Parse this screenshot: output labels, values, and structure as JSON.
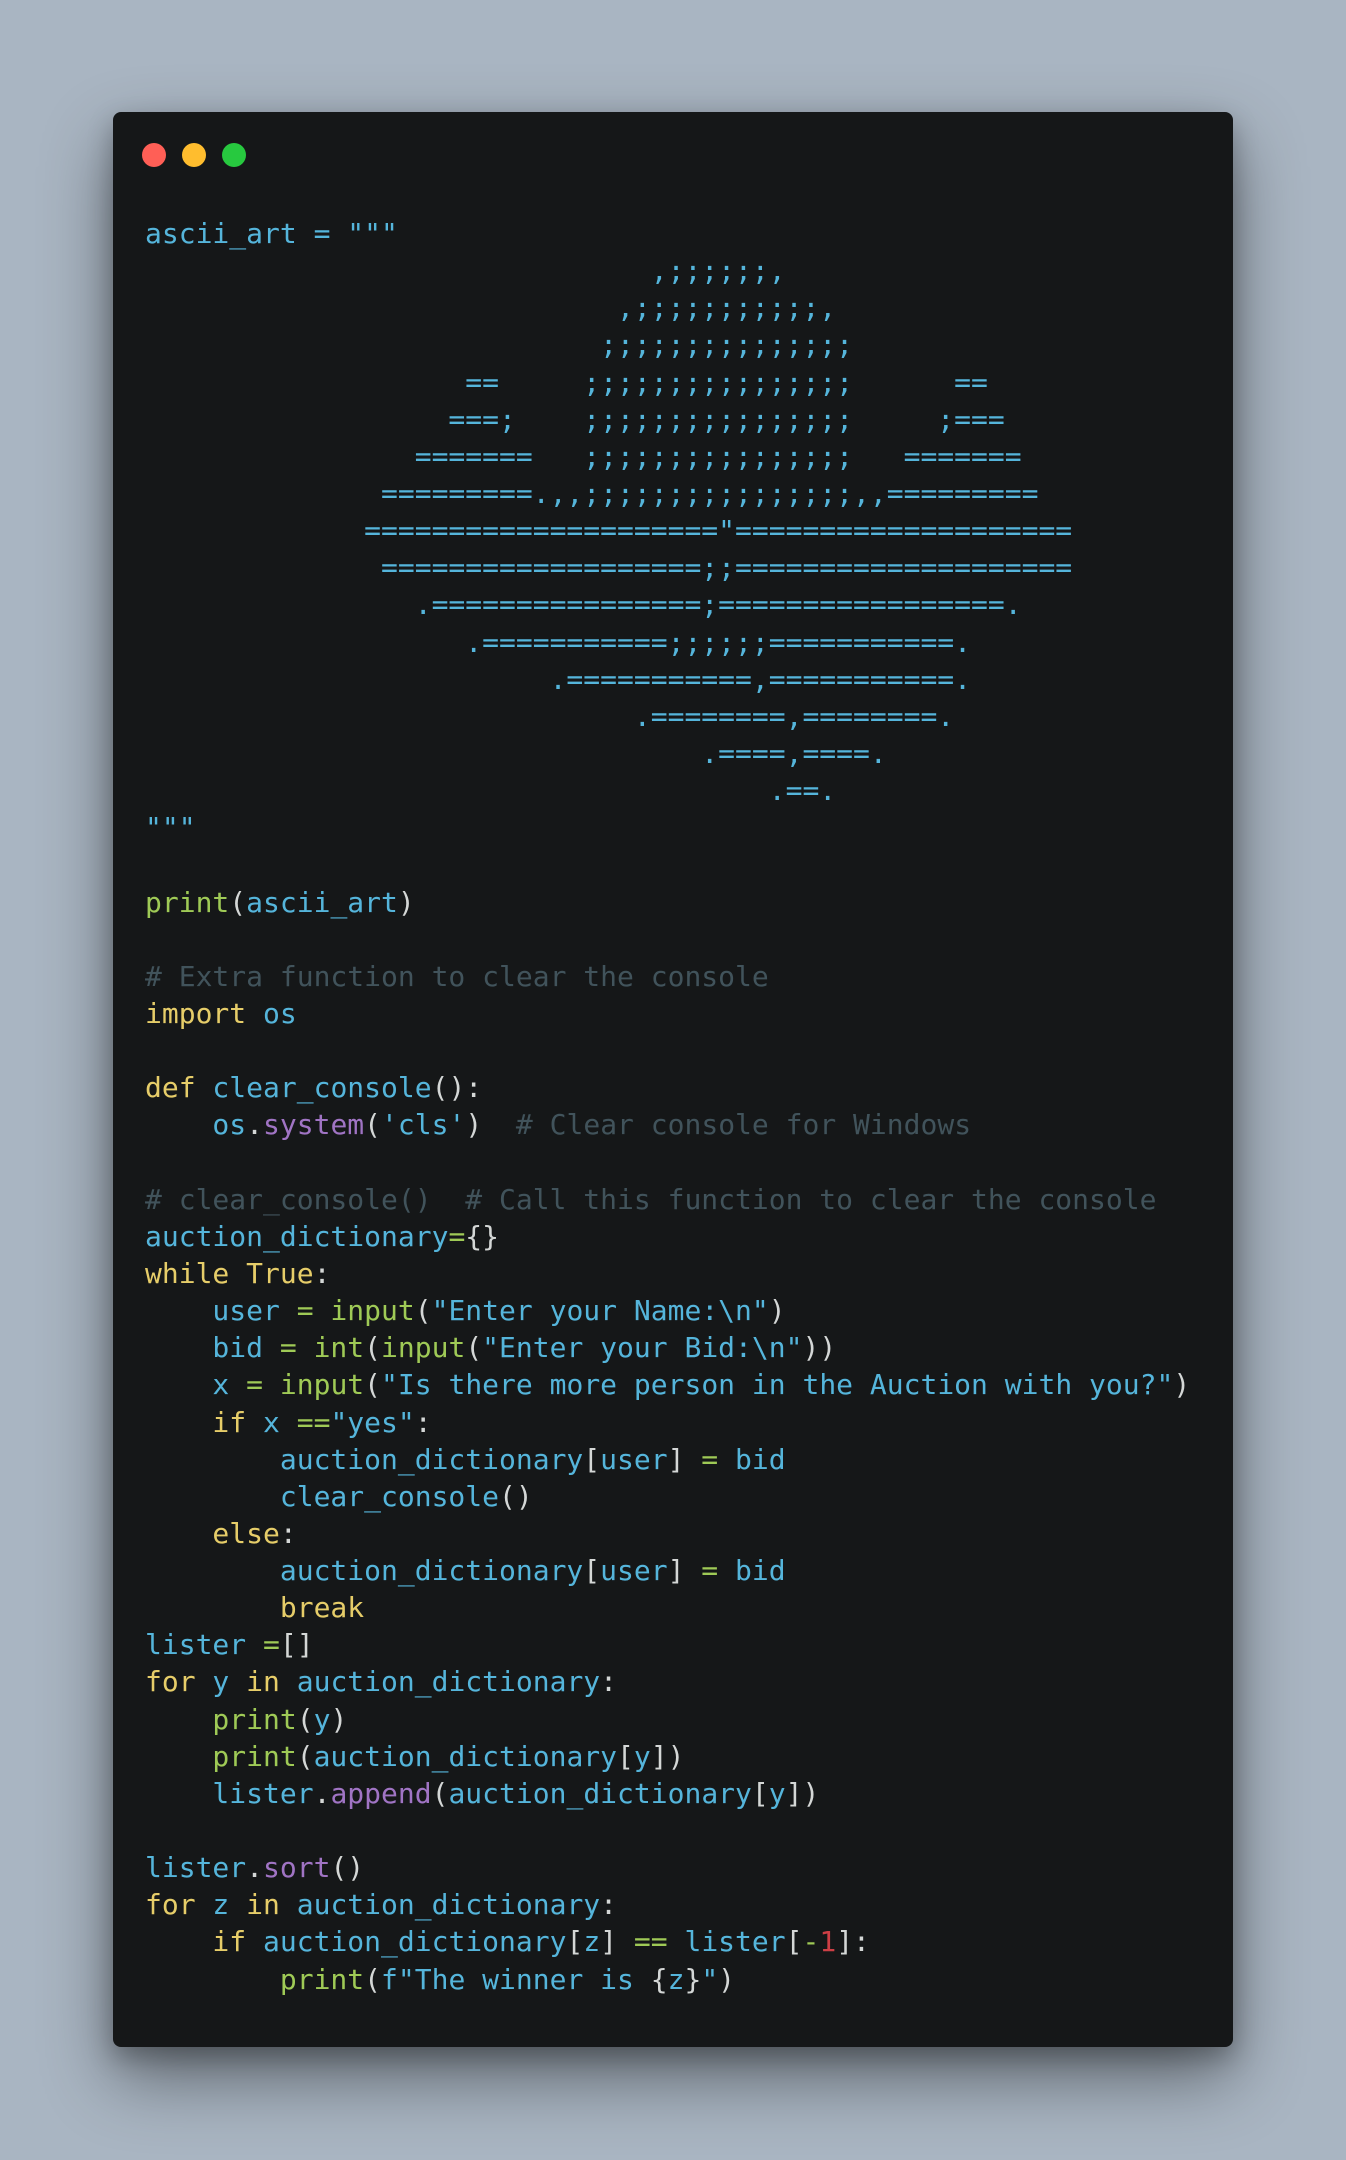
{
  "window": {
    "traffic_lights": [
      {
        "name": "close",
        "color": "#ff5f56"
      },
      {
        "name": "minimize",
        "color": "#ffbd2e"
      },
      {
        "name": "maximize",
        "color": "#27c93f"
      }
    ]
  },
  "colors": {
    "background": "#a9b5c2",
    "editor": "#151718",
    "keyword": "#e6cd69",
    "function": "#9fca56",
    "variable": "#55b5db",
    "comment": "#41535b",
    "method": "#a074c4",
    "punctuation": "#d4d7d6",
    "number": "#cd3f45"
  },
  "code": {
    "lines": [
      [
        {
          "t": "ascii_art = \"\"\"",
          "c": "var"
        }
      ],
      [
        {
          "t": "                              ,;;;;;;,",
          "c": "str"
        }
      ],
      [
        {
          "t": "                            ,;;;;;;;;;;;,",
          "c": "str"
        }
      ],
      [
        {
          "t": "                           ;;;;;;;;;;;;;;;",
          "c": "str"
        }
      ],
      [
        {
          "t": "                   ==     ;;;;;;;;;;;;;;;;      ==",
          "c": "str"
        }
      ],
      [
        {
          "t": "                  ===;    ;;;;;;;;;;;;;;;;     ;===",
          "c": "str"
        }
      ],
      [
        {
          "t": "                =======   ;;;;;;;;;;;;;;;;   =======",
          "c": "str"
        }
      ],
      [
        {
          "t": "              =========.,,;;;;;;;;;;;;;;;;,,=========",
          "c": "str"
        }
      ],
      [
        {
          "t": "             =====================\"====================",
          "c": "str"
        }
      ],
      [
        {
          "t": "              ===================;;====================",
          "c": "str"
        }
      ],
      [
        {
          "t": "                .================;=================.",
          "c": "str"
        }
      ],
      [
        {
          "t": "                   .===========;;;;;;===========.",
          "c": "str"
        }
      ],
      [
        {
          "t": "                        .===========,===========.",
          "c": "str"
        }
      ],
      [
        {
          "t": "                             .========,========.",
          "c": "str"
        }
      ],
      [
        {
          "t": "                                 .====,====.",
          "c": "str"
        }
      ],
      [
        {
          "t": "                                     .==.",
          "c": "str"
        }
      ],
      [
        {
          "t": "\"\"\"",
          "c": "str"
        }
      ],
      [],
      [
        {
          "t": "print",
          "c": "fn"
        },
        {
          "t": "(",
          "c": "pn"
        },
        {
          "t": "ascii_art",
          "c": "var"
        },
        {
          "t": ")",
          "c": "pn"
        }
      ],
      [],
      [
        {
          "t": "# Extra function to clear the console",
          "c": "cm"
        }
      ],
      [
        {
          "t": "import",
          "c": "kw"
        },
        {
          "t": " os",
          "c": "var"
        }
      ],
      [],
      [
        {
          "t": "def",
          "c": "kw"
        },
        {
          "t": " clear_console",
          "c": "var"
        },
        {
          "t": "():",
          "c": "pn"
        }
      ],
      [
        {
          "t": "    os",
          "c": "var"
        },
        {
          "t": ".",
          "c": "pn"
        },
        {
          "t": "system",
          "c": "mt"
        },
        {
          "t": "(",
          "c": "pn"
        },
        {
          "t": "'cls'",
          "c": "str"
        },
        {
          "t": ")",
          "c": "pn"
        },
        {
          "t": "  # Clear console for Windows",
          "c": "cm"
        }
      ],
      [],
      [
        {
          "t": "# clear_console()  # Call this function to clear the console",
          "c": "cm"
        }
      ],
      [
        {
          "t": "auction_dictionary",
          "c": "var"
        },
        {
          "t": "=",
          "c": "op"
        },
        {
          "t": "{}",
          "c": "pn"
        }
      ],
      [
        {
          "t": "while",
          "c": "kw"
        },
        {
          "t": " True",
          "c": "kw"
        },
        {
          "t": ":",
          "c": "pn"
        }
      ],
      [
        {
          "t": "    user ",
          "c": "var"
        },
        {
          "t": "=",
          "c": "op"
        },
        {
          "t": " input",
          "c": "fn"
        },
        {
          "t": "(",
          "c": "pn"
        },
        {
          "t": "\"Enter your Name:\\n\"",
          "c": "str"
        },
        {
          "t": ")",
          "c": "pn"
        }
      ],
      [
        {
          "t": "    bid ",
          "c": "var"
        },
        {
          "t": "=",
          "c": "op"
        },
        {
          "t": " int",
          "c": "fn"
        },
        {
          "t": "(",
          "c": "pn"
        },
        {
          "t": "input",
          "c": "fn"
        },
        {
          "t": "(",
          "c": "pn"
        },
        {
          "t": "\"Enter your Bid:\\n\"",
          "c": "str"
        },
        {
          "t": "))",
          "c": "pn"
        }
      ],
      [
        {
          "t": "    x ",
          "c": "var"
        },
        {
          "t": "=",
          "c": "op"
        },
        {
          "t": " input",
          "c": "fn"
        },
        {
          "t": "(",
          "c": "pn"
        },
        {
          "t": "\"Is there more person in the Auction with you?\"",
          "c": "str"
        },
        {
          "t": ")",
          "c": "pn"
        }
      ],
      [
        {
          "t": "    if",
          "c": "kw"
        },
        {
          "t": " x ",
          "c": "var"
        },
        {
          "t": "==",
          "c": "op"
        },
        {
          "t": "\"yes\"",
          "c": "str"
        },
        {
          "t": ":",
          "c": "pn"
        }
      ],
      [
        {
          "t": "        auction_dictionary",
          "c": "var"
        },
        {
          "t": "[",
          "c": "pn"
        },
        {
          "t": "user",
          "c": "var"
        },
        {
          "t": "]",
          "c": "pn"
        },
        {
          "t": " = ",
          "c": "op"
        },
        {
          "t": "bid",
          "c": "var"
        }
      ],
      [
        {
          "t": "        clear_console",
          "c": "var"
        },
        {
          "t": "()",
          "c": "pn"
        }
      ],
      [
        {
          "t": "    else",
          "c": "kw"
        },
        {
          "t": ":",
          "c": "pn"
        }
      ],
      [
        {
          "t": "        auction_dictionary",
          "c": "var"
        },
        {
          "t": "[",
          "c": "pn"
        },
        {
          "t": "user",
          "c": "var"
        },
        {
          "t": "]",
          "c": "pn"
        },
        {
          "t": " = ",
          "c": "op"
        },
        {
          "t": "bid",
          "c": "var"
        }
      ],
      [
        {
          "t": "        break",
          "c": "kw"
        }
      ],
      [
        {
          "t": "lister ",
          "c": "var"
        },
        {
          "t": "=",
          "c": "op"
        },
        {
          "t": "[]",
          "c": "pn"
        }
      ],
      [
        {
          "t": "for",
          "c": "kw"
        },
        {
          "t": " y ",
          "c": "var"
        },
        {
          "t": "in",
          "c": "kw"
        },
        {
          "t": " auction_dictionary",
          "c": "var"
        },
        {
          "t": ":",
          "c": "pn"
        }
      ],
      [
        {
          "t": "    print",
          "c": "fn"
        },
        {
          "t": "(",
          "c": "pn"
        },
        {
          "t": "y",
          "c": "var"
        },
        {
          "t": ")",
          "c": "pn"
        }
      ],
      [
        {
          "t": "    print",
          "c": "fn"
        },
        {
          "t": "(",
          "c": "pn"
        },
        {
          "t": "auction_dictionary",
          "c": "var"
        },
        {
          "t": "[",
          "c": "pn"
        },
        {
          "t": "y",
          "c": "var"
        },
        {
          "t": "])",
          "c": "pn"
        }
      ],
      [
        {
          "t": "    lister",
          "c": "var"
        },
        {
          "t": ".",
          "c": "pn"
        },
        {
          "t": "append",
          "c": "mt"
        },
        {
          "t": "(",
          "c": "pn"
        },
        {
          "t": "auction_dictionary",
          "c": "var"
        },
        {
          "t": "[",
          "c": "pn"
        },
        {
          "t": "y",
          "c": "var"
        },
        {
          "t": "])",
          "c": "pn"
        }
      ],
      [],
      [
        {
          "t": "lister",
          "c": "var"
        },
        {
          "t": ".",
          "c": "pn"
        },
        {
          "t": "sort",
          "c": "mt"
        },
        {
          "t": "()",
          "c": "pn"
        }
      ],
      [
        {
          "t": "for",
          "c": "kw"
        },
        {
          "t": " z ",
          "c": "var"
        },
        {
          "t": "in",
          "c": "kw"
        },
        {
          "t": " auction_dictionary",
          "c": "var"
        },
        {
          "t": ":",
          "c": "pn"
        }
      ],
      [
        {
          "t": "    if",
          "c": "kw"
        },
        {
          "t": " auction_dictionary",
          "c": "var"
        },
        {
          "t": "[",
          "c": "pn"
        },
        {
          "t": "z",
          "c": "var"
        },
        {
          "t": "]",
          "c": "pn"
        },
        {
          "t": " == ",
          "c": "op"
        },
        {
          "t": "lister",
          "c": "var"
        },
        {
          "t": "[",
          "c": "pn"
        },
        {
          "t": "-",
          "c": "op"
        },
        {
          "t": "1",
          "c": "num"
        },
        {
          "t": "]:",
          "c": "pn"
        }
      ],
      [
        {
          "t": "        print",
          "c": "fn"
        },
        {
          "t": "(",
          "c": "pn"
        },
        {
          "t": "f\"The winner is ",
          "c": "str"
        },
        {
          "t": "{",
          "c": "pn"
        },
        {
          "t": "z",
          "c": "var"
        },
        {
          "t": "}",
          "c": "pn"
        },
        {
          "t": "\"",
          "c": "str"
        },
        {
          "t": ")",
          "c": "pn"
        }
      ]
    ]
  }
}
